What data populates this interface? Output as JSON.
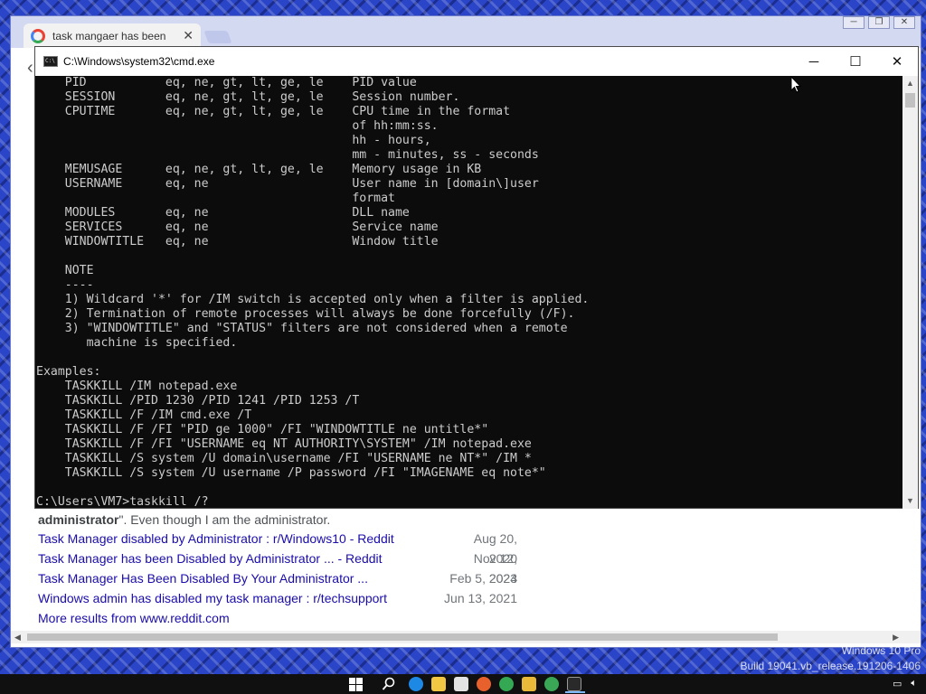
{
  "browser": {
    "tab_title": "task mangaer has been",
    "tab_close": "✕",
    "window_buttons": [
      "─",
      "❐",
      "✕"
    ]
  },
  "cmd": {
    "title": "C:\\Windows\\system32\\cmd.exe",
    "buttons": [
      "─",
      "☐",
      "✕"
    ],
    "lines": [
      "    PID           eq, ne, gt, lt, ge, le    PID value",
      "    SESSION       eq, ne, gt, lt, ge, le    Session number.",
      "    CPUTIME       eq, ne, gt, lt, ge, le    CPU time in the format",
      "                                            of hh:mm:ss.",
      "                                            hh - hours,",
      "                                            mm - minutes, ss - seconds",
      "    MEMUSAGE      eq, ne, gt, lt, ge, le    Memory usage in KB",
      "    USERNAME      eq, ne                    User name in [domain\\]user",
      "                                            format",
      "    MODULES       eq, ne                    DLL name",
      "    SERVICES      eq, ne                    Service name",
      "    WINDOWTITLE   eq, ne                    Window title",
      "",
      "    NOTE",
      "    ----",
      "    1) Wildcard '*' for /IM switch is accepted only when a filter is applied.",
      "    2) Termination of remote processes will always be done forcefully (/F).",
      "    3) \"WINDOWTITLE\" and \"STATUS\" filters are not considered when a remote",
      "       machine is specified.",
      "",
      "Examples:",
      "    TASKKILL /IM notepad.exe",
      "    TASKKILL /PID 1230 /PID 1241 /PID 1253 /T",
      "    TASKKILL /F /IM cmd.exe /T",
      "    TASKKILL /F /FI \"PID ge 1000\" /FI \"WINDOWTITLE ne untitle*\"",
      "    TASKKILL /F /FI \"USERNAME eq NT AUTHORITY\\SYSTEM\" /IM notepad.exe",
      "    TASKKILL /S system /U domain\\username /FI \"USERNAME ne NT*\" /IM *",
      "    TASKKILL /S system /U username /P password /FI \"IMAGENAME eq note*\"",
      "",
      "C:\\Users\\VM7>taskkill /?"
    ]
  },
  "search": {
    "snippet_bold": "administrator",
    "snippet_rest": "\". Even though I am the administrator.",
    "results": [
      {
        "title": "Task Manager disabled by Administrator : r/Windows10 - Reddit",
        "date": "Aug 20, 2020"
      },
      {
        "title": "Task Manager has been Disabled by Administrator ... - Reddit",
        "date": "Nov 12, 2023"
      },
      {
        "title": "Task Manager Has Been Disabled By Your Administrator ...",
        "date": "Feb 5, 2024"
      },
      {
        "title": "Windows admin has disabled my task manager : r/techsupport",
        "date": "Jun 13, 2021"
      }
    ],
    "more": "More results from www.reddit.com"
  },
  "watermark": {
    "line1": "Windows 10 Pro",
    "line2": "Build 19041.vb_release.191206-1406"
  },
  "taskbar": {
    "icons": [
      "start-icon",
      "search-icon",
      "edge-icon",
      "file-explorer-icon",
      "store-icon",
      "firefox-icon",
      "chrome-icon",
      "folder-icon",
      "green-app-icon",
      "cmd-icon"
    ]
  }
}
